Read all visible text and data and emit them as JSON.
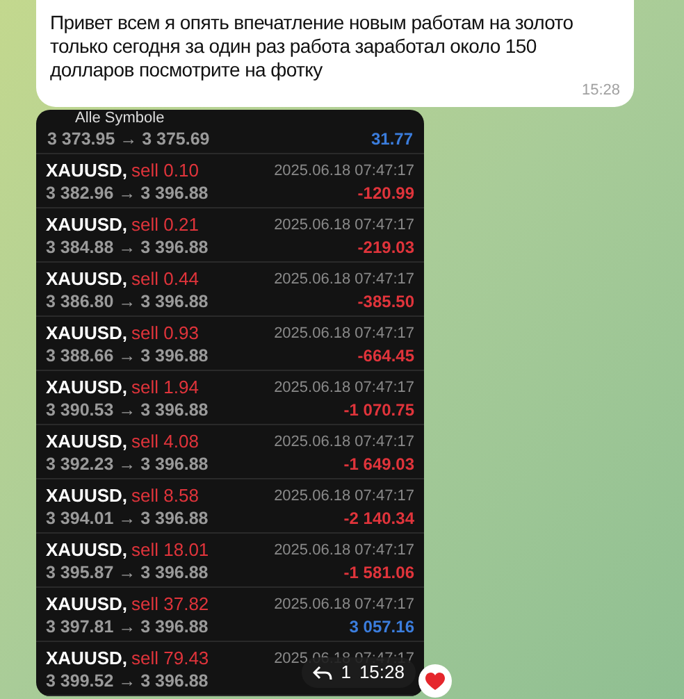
{
  "message": {
    "text": "Привет всем я опять впечатление новым работам на золото только сегодня за один  раз работа заработал около 150 долларов посмотрите на фотку",
    "time": "15:28"
  },
  "photo": {
    "header": "Alle Symbole",
    "top_row": {
      "prices": "3 373.95 → 3 375.69",
      "profit": "31.77",
      "profit_positive": true
    },
    "trades": [
      {
        "symbol": "XAUUSD,",
        "side": "sell 0.10",
        "prices": "3 382.96 → 3 396.88",
        "date": "2025.06.18 07:47:17",
        "profit": "-120.99",
        "profit_positive": false
      },
      {
        "symbol": "XAUUSD,",
        "side": "sell 0.21",
        "prices": "3 384.88 → 3 396.88",
        "date": "2025.06.18 07:47:17",
        "profit": "-219.03",
        "profit_positive": false
      },
      {
        "symbol": "XAUUSD,",
        "side": "sell 0.44",
        "prices": "3 386.80 → 3 396.88",
        "date": "2025.06.18 07:47:17",
        "profit": "-385.50",
        "profit_positive": false
      },
      {
        "symbol": "XAUUSD,",
        "side": "sell 0.93",
        "prices": "3 388.66 → 3 396.88",
        "date": "2025.06.18 07:47:17",
        "profit": "-664.45",
        "profit_positive": false
      },
      {
        "symbol": "XAUUSD,",
        "side": "sell 1.94",
        "prices": "3 390.53 → 3 396.88",
        "date": "2025.06.18 07:47:17",
        "profit": "-1 070.75",
        "profit_positive": false
      },
      {
        "symbol": "XAUUSD,",
        "side": "sell 4.08",
        "prices": "3 392.23 → 3 396.88",
        "date": "2025.06.18 07:47:17",
        "profit": "-1 649.03",
        "profit_positive": false
      },
      {
        "symbol": "XAUUSD,",
        "side": "sell 8.58",
        "prices": "3 394.01 → 3 396.88",
        "date": "2025.06.18 07:47:17",
        "profit": "-2 140.34",
        "profit_positive": false
      },
      {
        "symbol": "XAUUSD,",
        "side": "sell 18.01",
        "prices": "3 395.87 → 3 396.88",
        "date": "2025.06.18 07:47:17",
        "profit": "-1 581.06",
        "profit_positive": false
      },
      {
        "symbol": "XAUUSD,",
        "side": "sell 37.82",
        "prices": "3 397.81 → 3 396.88",
        "date": "2025.06.18 07:47:17",
        "profit": "3 057.16",
        "profit_positive": true
      },
      {
        "symbol": "XAUUSD,",
        "side": "sell 79.43",
        "prices": "3 399.52 → 3 396.88",
        "date": "2025.06.18 07:47:17"
      }
    ],
    "overlay": {
      "reply_count": "1",
      "time": "15:28"
    }
  },
  "reaction": {
    "kind": "heart"
  }
}
